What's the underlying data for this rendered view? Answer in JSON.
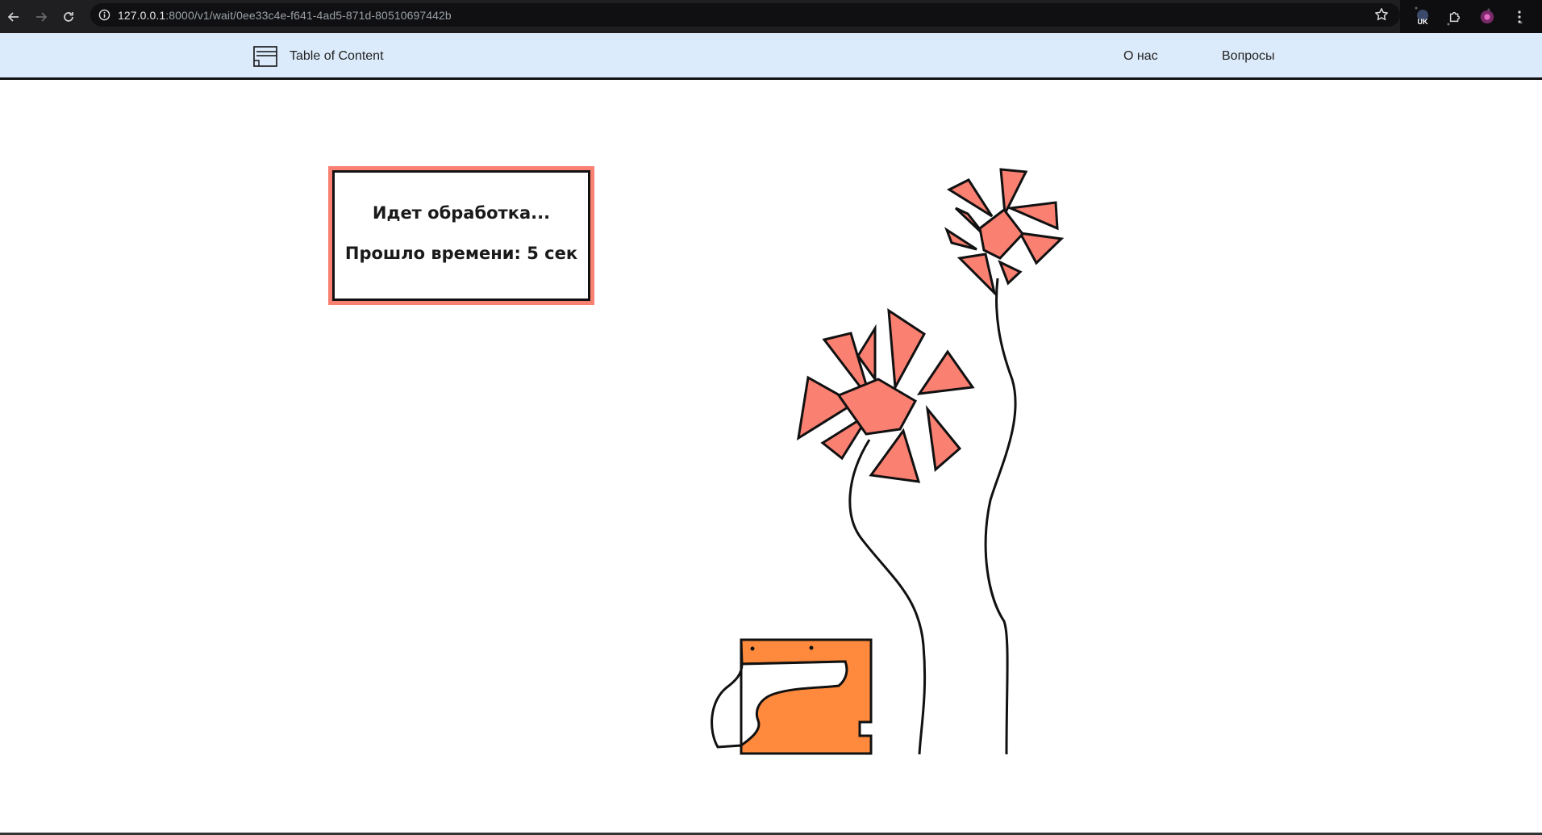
{
  "browser": {
    "url_host": "127.0.0.1",
    "url_rest": ":8000/v1/wait/0ee33c4e-f641-4ad5-871d-80510697442b",
    "extension_badge": "UK"
  },
  "header": {
    "logo_text": "Table of Content",
    "nav": [
      {
        "label": "О нас"
      },
      {
        "label": "Вопросы"
      }
    ]
  },
  "status": {
    "title": "Идет обработка...",
    "elapsed": "Прошло времени: 5 сек"
  },
  "colors": {
    "accent": "#fa8072",
    "header_bg": "#dcebfb",
    "box_orange": "#ff8a3d"
  }
}
